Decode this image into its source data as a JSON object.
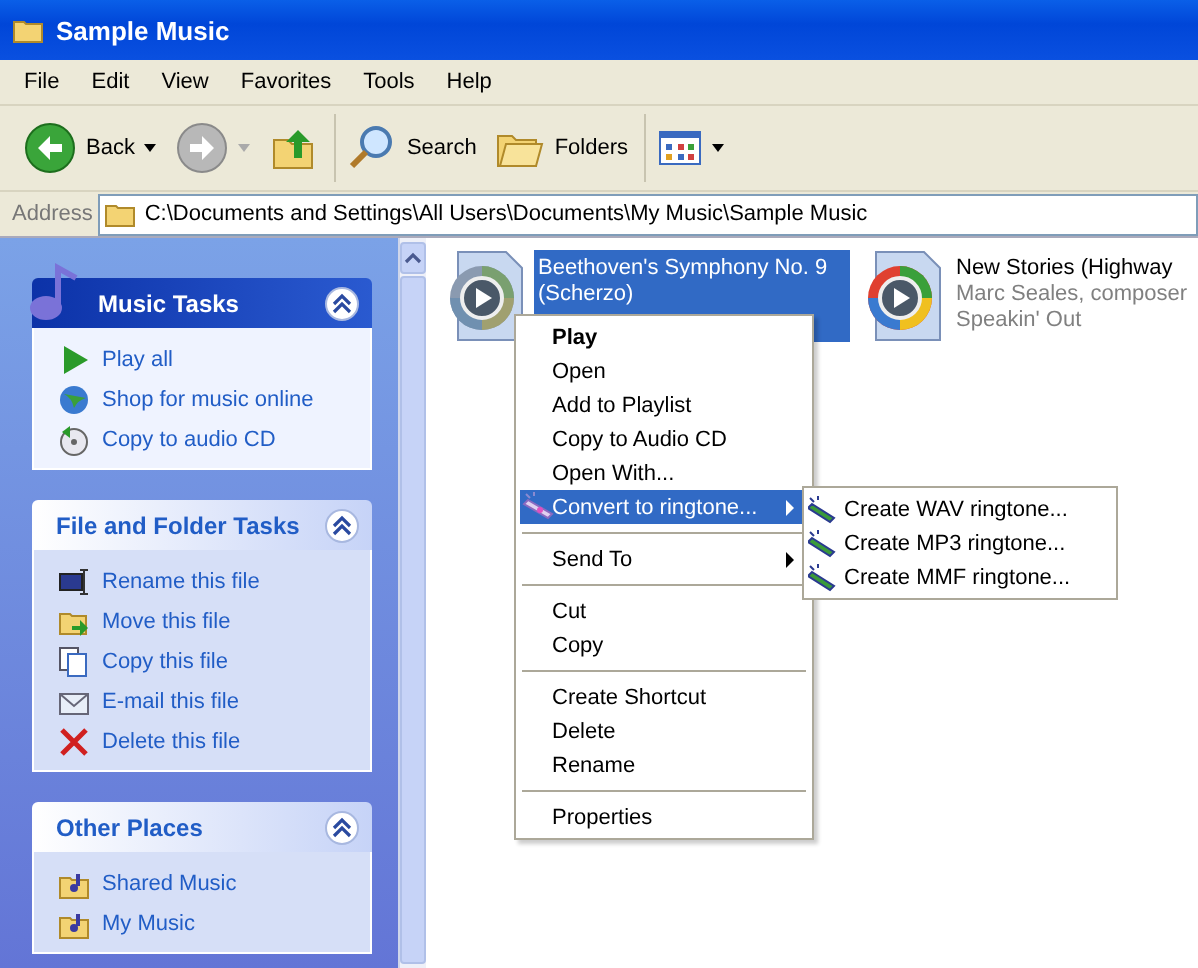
{
  "window": {
    "title": "Sample Music"
  },
  "menu_bar": [
    "File",
    "Edit",
    "View",
    "Favorites",
    "Tools",
    "Help"
  ],
  "toolbar": [
    {
      "kind": "back",
      "label": "Back"
    },
    {
      "kind": "forward"
    },
    {
      "kind": "up"
    },
    {
      "kind": "search",
      "label": "Search"
    },
    {
      "kind": "folders",
      "label": "Folders"
    },
    {
      "kind": "views"
    }
  ],
  "address": {
    "label": "Address",
    "value": "C:\\Documents and Settings\\All Users\\Documents\\My Music\\Sample Music"
  },
  "task_panels": [
    {
      "title": "Music Tasks",
      "kind": "special",
      "items": [
        "Play all",
        "Shop for music online",
        "Copy to audio CD"
      ]
    },
    {
      "title": "File and Folder Tasks",
      "kind": "normal",
      "items": [
        "Rename this file",
        "Move this file",
        "Copy this file",
        "E-mail this file",
        "Delete this file"
      ]
    },
    {
      "title": "Other Places",
      "kind": "normal",
      "items": [
        "Shared Music",
        "My Music"
      ]
    }
  ],
  "files": [
    {
      "lines": [
        "Beethoven's Symphony No. 9",
        "(Scherzo)"
      ],
      "selected": true
    },
    {
      "lines": [
        "New Stories (Highway",
        "Marc Seales, composer",
        "Speakin' Out"
      ],
      "selected": false
    }
  ],
  "context_menu": [
    {
      "kind": "item",
      "label": "Play",
      "bold": true,
      "selected": false
    },
    {
      "kind": "item",
      "label": "Open",
      "bold": false,
      "selected": false
    },
    {
      "kind": "item",
      "label": "Add to Playlist",
      "bold": false,
      "selected": false
    },
    {
      "kind": "item",
      "label": "Copy to Audio CD",
      "bold": false,
      "selected": false
    },
    {
      "kind": "item",
      "label": "Open With...",
      "bold": false,
      "selected": false
    },
    {
      "kind": "submenu",
      "label": "Convert to ringtone...",
      "bold": false,
      "selected": true,
      "icon": true
    },
    {
      "kind": "separator"
    },
    {
      "kind": "submenu",
      "label": "Send To",
      "bold": false,
      "selected": false,
      "icon": false
    },
    {
      "kind": "separator"
    },
    {
      "kind": "item",
      "label": "Cut",
      "bold": false,
      "selected": false
    },
    {
      "kind": "item",
      "label": "Copy",
      "bold": false,
      "selected": false
    },
    {
      "kind": "separator"
    },
    {
      "kind": "item",
      "label": "Create Shortcut",
      "bold": false,
      "selected": false
    },
    {
      "kind": "item",
      "label": "Delete",
      "bold": false,
      "selected": false
    },
    {
      "kind": "item",
      "label": "Rename",
      "bold": false,
      "selected": false
    },
    {
      "kind": "separator"
    },
    {
      "kind": "item",
      "label": "Properties",
      "bold": false,
      "selected": false
    }
  ],
  "submenu": [
    "Create WAV ringtone...",
    "Create MP3 ringtone...",
    "Create MMF ringtone..."
  ]
}
